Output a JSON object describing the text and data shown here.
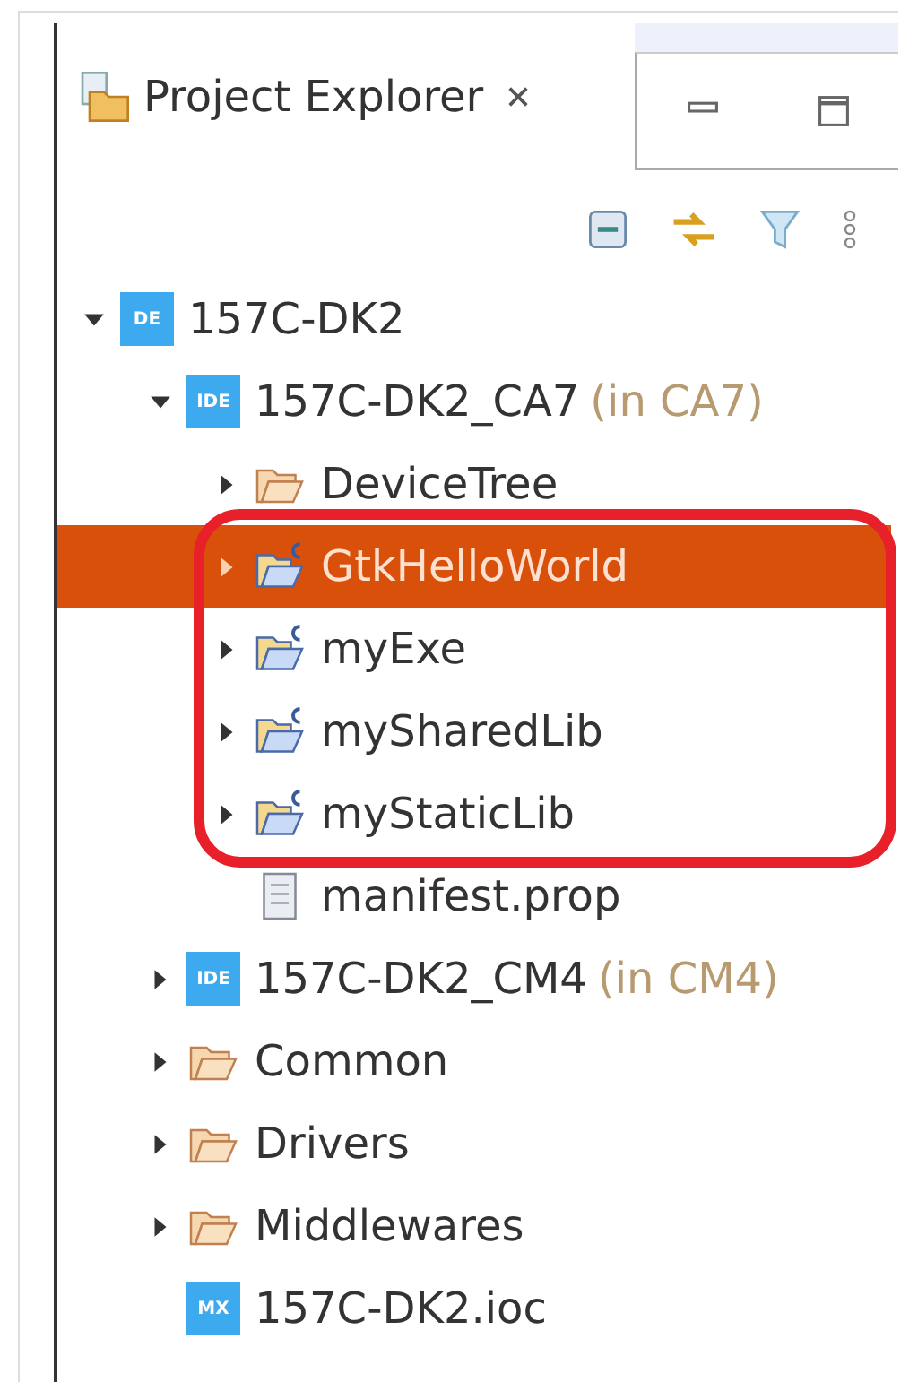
{
  "panel": {
    "title": "Project Explorer"
  },
  "tree": [
    {
      "label": "157C-DK2",
      "kind": "project",
      "badge": "DE",
      "expanded": true,
      "selected": false,
      "children": [
        {
          "label": "157C-DK2_CA7",
          "suffix": "(in CA7)",
          "kind": "project",
          "badge": "IDE",
          "expanded": true,
          "selected": false,
          "children": [
            {
              "label": "DeviceTree",
              "kind": "folder",
              "expanded": false,
              "selected": false
            },
            {
              "label": "GtkHelloWorld",
              "kind": "cproject",
              "expanded": false,
              "selected": true
            },
            {
              "label": "myExe",
              "kind": "cproject",
              "expanded": false,
              "selected": false
            },
            {
              "label": "mySharedLib",
              "kind": "cproject",
              "expanded": false,
              "selected": false
            },
            {
              "label": "myStaticLib",
              "kind": "cproject",
              "expanded": false,
              "selected": false
            },
            {
              "label": "manifest.prop",
              "kind": "file",
              "selected": false
            }
          ]
        },
        {
          "label": "157C-DK2_CM4",
          "suffix": "(in CM4)",
          "kind": "project",
          "badge": "IDE",
          "expanded": false,
          "selected": false
        },
        {
          "label": "Common",
          "kind": "folder",
          "expanded": false,
          "selected": false
        },
        {
          "label": "Drivers",
          "kind": "folder",
          "expanded": false,
          "selected": false
        },
        {
          "label": "Middlewares",
          "kind": "folder",
          "expanded": false,
          "selected": false
        },
        {
          "label": "157C-DK2.ioc",
          "kind": "ioc",
          "badge": "MX",
          "selected": false
        }
      ]
    }
  ]
}
